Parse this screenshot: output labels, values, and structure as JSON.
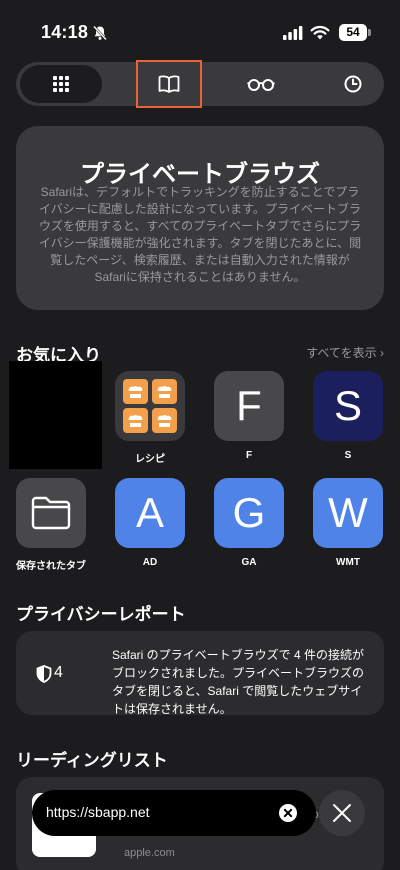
{
  "status_bar": {
    "time": "14:18",
    "battery": "54",
    "icons": [
      "bell-slash-icon",
      "signal-icon",
      "wifi-icon",
      "battery-icon"
    ]
  },
  "segments": [
    {
      "name": "tabs",
      "icon": "grid-icon",
      "selected": true
    },
    {
      "name": "bookmarks",
      "icon": "book-icon",
      "selected": false
    },
    {
      "name": "reading-list",
      "icon": "glasses-icon",
      "selected": false
    },
    {
      "name": "history",
      "icon": "clock-icon",
      "selected": false
    }
  ],
  "private_card": {
    "title": "プライベートブラウズ",
    "body": "Safariは、デフォルトでトラッキングを防止することでプライバシーに配慮した設計になっています。プライベートブラウズを使用すると、すべてのプライベートタブでさらにプライバシー保護機能が強化されます。タブを閉じたあとに、閲覧したページ、検索履歴、または自動入力された情報がSafariに保持されることはありません。"
  },
  "favorites": {
    "title": "お気に入り",
    "show_all": "すべてを表示 ›",
    "items": [
      {
        "label": "レシピ",
        "letter": "",
        "color": "#3a3a3c",
        "icon": "recipe-icon"
      },
      {
        "label": "F",
        "letter": "F",
        "color": "#48484a"
      },
      {
        "label": "S",
        "letter": "S",
        "color": "#1c1f5e"
      },
      {
        "label": "保存されたタブ",
        "letter": "",
        "color": "#48484a",
        "icon": "folder-icon"
      },
      {
        "label": "AD",
        "letter": "A",
        "color": "#4f83e8"
      },
      {
        "label": "GA",
        "letter": "G",
        "color": "#4f83e8"
      },
      {
        "label": "WMT",
        "letter": "W",
        "color": "#4f83e8"
      }
    ]
  },
  "privacy_report": {
    "title": "プライバシーレポート",
    "count": "4",
    "body": "Safari のプライベートブラウズで 4 件の接続がブロックされました。プライベートブラウズのタブを閉じると、Safari で閲覧したウェブサイトは保存されません。"
  },
  "reading_list": {
    "title": "リーディングリスト",
    "url": "apple.com",
    "tail": "pl"
  },
  "url_bar": {
    "text": "https://sbapp.net"
  }
}
